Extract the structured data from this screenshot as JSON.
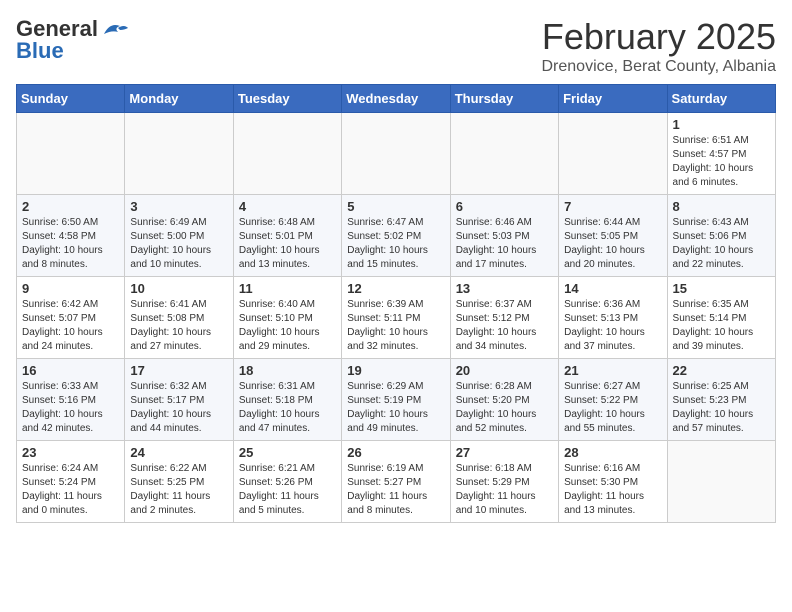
{
  "header": {
    "logo_general": "General",
    "logo_blue": "Blue",
    "month_year": "February 2025",
    "location": "Drenovice, Berat County, Albania"
  },
  "days_of_week": [
    "Sunday",
    "Monday",
    "Tuesday",
    "Wednesday",
    "Thursday",
    "Friday",
    "Saturday"
  ],
  "weeks": [
    [
      {
        "day": "",
        "info": ""
      },
      {
        "day": "",
        "info": ""
      },
      {
        "day": "",
        "info": ""
      },
      {
        "day": "",
        "info": ""
      },
      {
        "day": "",
        "info": ""
      },
      {
        "day": "",
        "info": ""
      },
      {
        "day": "1",
        "info": "Sunrise: 6:51 AM\nSunset: 4:57 PM\nDaylight: 10 hours and 6 minutes."
      }
    ],
    [
      {
        "day": "2",
        "info": "Sunrise: 6:50 AM\nSunset: 4:58 PM\nDaylight: 10 hours and 8 minutes."
      },
      {
        "day": "3",
        "info": "Sunrise: 6:49 AM\nSunset: 5:00 PM\nDaylight: 10 hours and 10 minutes."
      },
      {
        "day": "4",
        "info": "Sunrise: 6:48 AM\nSunset: 5:01 PM\nDaylight: 10 hours and 13 minutes."
      },
      {
        "day": "5",
        "info": "Sunrise: 6:47 AM\nSunset: 5:02 PM\nDaylight: 10 hours and 15 minutes."
      },
      {
        "day": "6",
        "info": "Sunrise: 6:46 AM\nSunset: 5:03 PM\nDaylight: 10 hours and 17 minutes."
      },
      {
        "day": "7",
        "info": "Sunrise: 6:44 AM\nSunset: 5:05 PM\nDaylight: 10 hours and 20 minutes."
      },
      {
        "day": "8",
        "info": "Sunrise: 6:43 AM\nSunset: 5:06 PM\nDaylight: 10 hours and 22 minutes."
      }
    ],
    [
      {
        "day": "9",
        "info": "Sunrise: 6:42 AM\nSunset: 5:07 PM\nDaylight: 10 hours and 24 minutes."
      },
      {
        "day": "10",
        "info": "Sunrise: 6:41 AM\nSunset: 5:08 PM\nDaylight: 10 hours and 27 minutes."
      },
      {
        "day": "11",
        "info": "Sunrise: 6:40 AM\nSunset: 5:10 PM\nDaylight: 10 hours and 29 minutes."
      },
      {
        "day": "12",
        "info": "Sunrise: 6:39 AM\nSunset: 5:11 PM\nDaylight: 10 hours and 32 minutes."
      },
      {
        "day": "13",
        "info": "Sunrise: 6:37 AM\nSunset: 5:12 PM\nDaylight: 10 hours and 34 minutes."
      },
      {
        "day": "14",
        "info": "Sunrise: 6:36 AM\nSunset: 5:13 PM\nDaylight: 10 hours and 37 minutes."
      },
      {
        "day": "15",
        "info": "Sunrise: 6:35 AM\nSunset: 5:14 PM\nDaylight: 10 hours and 39 minutes."
      }
    ],
    [
      {
        "day": "16",
        "info": "Sunrise: 6:33 AM\nSunset: 5:16 PM\nDaylight: 10 hours and 42 minutes."
      },
      {
        "day": "17",
        "info": "Sunrise: 6:32 AM\nSunset: 5:17 PM\nDaylight: 10 hours and 44 minutes."
      },
      {
        "day": "18",
        "info": "Sunrise: 6:31 AM\nSunset: 5:18 PM\nDaylight: 10 hours and 47 minutes."
      },
      {
        "day": "19",
        "info": "Sunrise: 6:29 AM\nSunset: 5:19 PM\nDaylight: 10 hours and 49 minutes."
      },
      {
        "day": "20",
        "info": "Sunrise: 6:28 AM\nSunset: 5:20 PM\nDaylight: 10 hours and 52 minutes."
      },
      {
        "day": "21",
        "info": "Sunrise: 6:27 AM\nSunset: 5:22 PM\nDaylight: 10 hours and 55 minutes."
      },
      {
        "day": "22",
        "info": "Sunrise: 6:25 AM\nSunset: 5:23 PM\nDaylight: 10 hours and 57 minutes."
      }
    ],
    [
      {
        "day": "23",
        "info": "Sunrise: 6:24 AM\nSunset: 5:24 PM\nDaylight: 11 hours and 0 minutes."
      },
      {
        "day": "24",
        "info": "Sunrise: 6:22 AM\nSunset: 5:25 PM\nDaylight: 11 hours and 2 minutes."
      },
      {
        "day": "25",
        "info": "Sunrise: 6:21 AM\nSunset: 5:26 PM\nDaylight: 11 hours and 5 minutes."
      },
      {
        "day": "26",
        "info": "Sunrise: 6:19 AM\nSunset: 5:27 PM\nDaylight: 11 hours and 8 minutes."
      },
      {
        "day": "27",
        "info": "Sunrise: 6:18 AM\nSunset: 5:29 PM\nDaylight: 11 hours and 10 minutes."
      },
      {
        "day": "28",
        "info": "Sunrise: 6:16 AM\nSunset: 5:30 PM\nDaylight: 11 hours and 13 minutes."
      },
      {
        "day": "",
        "info": ""
      }
    ]
  ]
}
